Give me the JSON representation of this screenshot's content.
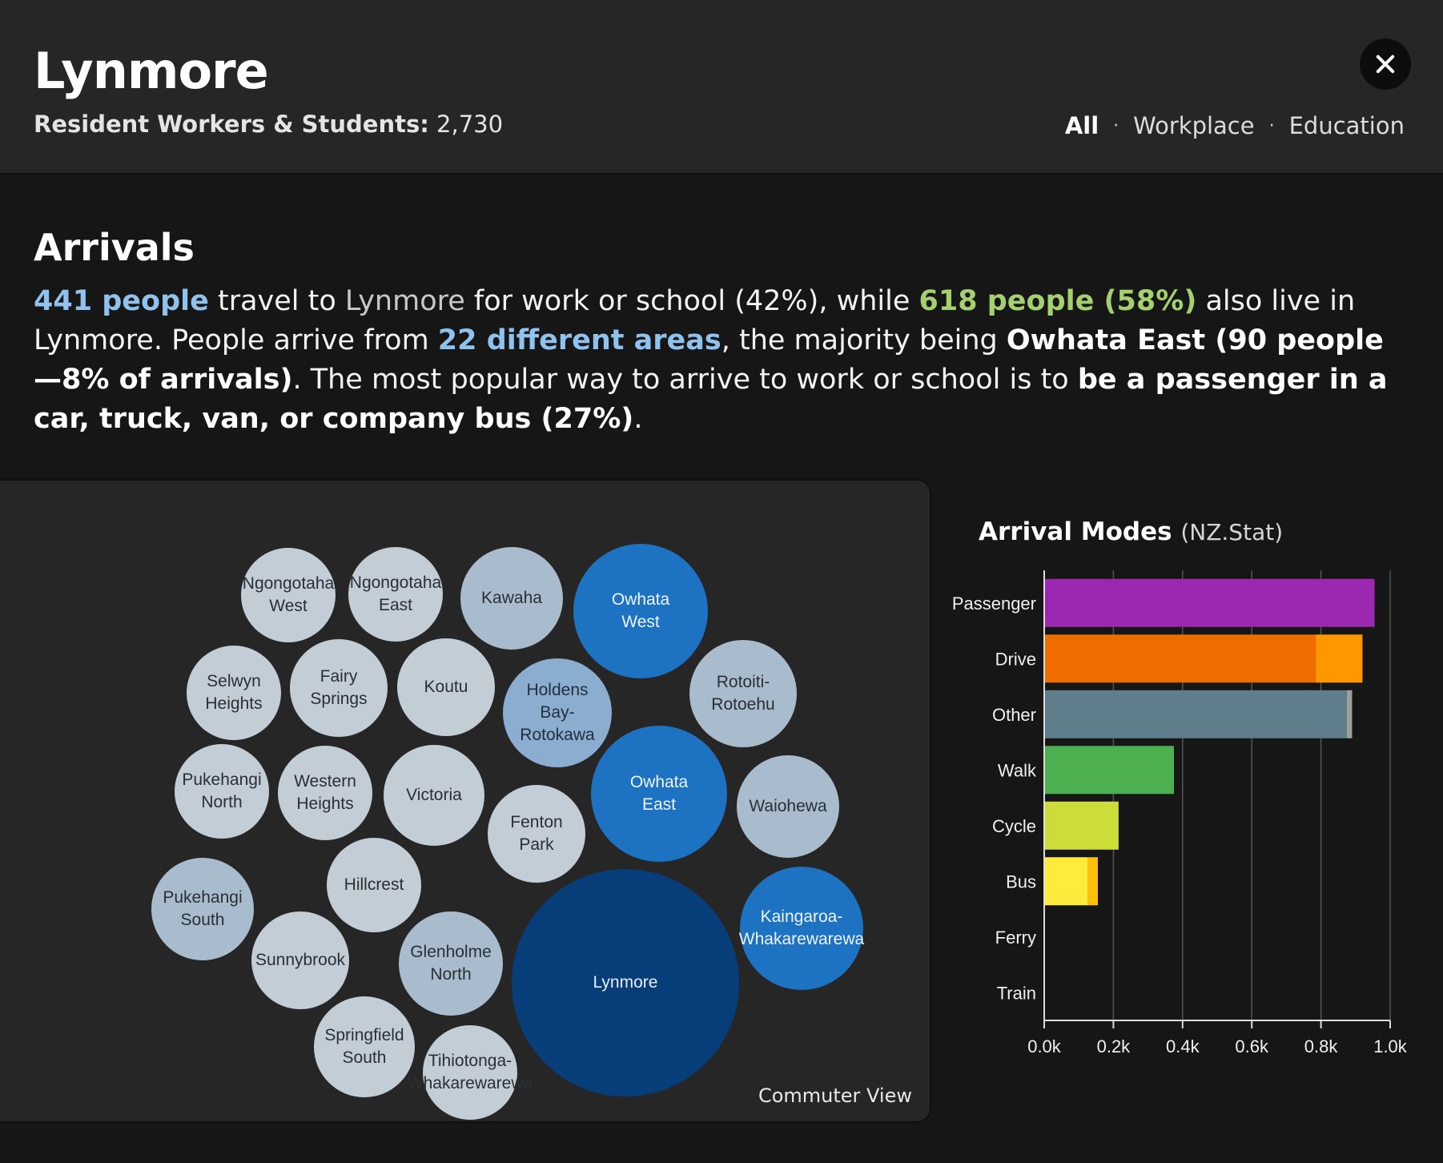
{
  "header": {
    "title": "Lynmore",
    "residents_label": "Resident Workers & Students:",
    "residents_value": "2,730",
    "filters": [
      "All",
      "Workplace",
      "Education"
    ],
    "active_filter": "All"
  },
  "arrivals": {
    "heading": "Arrivals",
    "summary": {
      "p1_count": "441 people",
      "p1_mid": " travel to ",
      "p1_place": "Lynmore",
      "p1_rest": " for work or school (42%), while ",
      "p1_local": "618 people (58%)",
      "p1_end": " also live in Lynmore. People arrive from ",
      "areas": "22 different areas",
      "p2_mid": ", the majority being ",
      "top_area": "Owhata East (90 people—8% of arrivals)",
      "p2_end": ". The most popular way to arrive to work or school is to ",
      "top_mode": "be a passenger in a car, truck, van, or company bus (27%)",
      "p3_end": "."
    }
  },
  "bubbles": {
    "items": [
      {
        "label": "Ngongotaha\nWest"
      },
      {
        "label": "Ngongotaha\nEast"
      },
      {
        "label": "Kawaha"
      },
      {
        "label": "Owhata\nWest"
      },
      {
        "label": "Selwyn\nHeights"
      },
      {
        "label": "Fairy\nSprings"
      },
      {
        "label": "Koutu"
      },
      {
        "label": "Holdens\nBay-\nRotokawa"
      },
      {
        "label": "Rotoiti-\nRotoehu"
      },
      {
        "label": "Pukehangi\nNorth"
      },
      {
        "label": "Western\nHeights"
      },
      {
        "label": "Victoria"
      },
      {
        "label": "Fenton\nPark"
      },
      {
        "label": "Owhata\nEast"
      },
      {
        "label": "Waiohewa"
      },
      {
        "label": "Pukehangi\nSouth"
      },
      {
        "label": "Hillcrest"
      },
      {
        "label": "Sunnybrook"
      },
      {
        "label": "Glenholme\nNorth"
      },
      {
        "label": "Lynmore"
      },
      {
        "label": "Kaingaroa-\nWhakarewarewa"
      },
      {
        "label": "Springfield\nSouth"
      },
      {
        "label": "Tihiotonga-\nWhakarewarewa"
      }
    ],
    "view_toggle": "Commuter View"
  },
  "chart_title": "Arrival Modes",
  "chart_source": "(NZ.Stat)",
  "chart_data": {
    "type": "bar",
    "orientation": "horizontal",
    "categories": [
      "Passenger",
      "Drive",
      "Other",
      "Walk",
      "Cycle",
      "Bus",
      "Ferry",
      "Train"
    ],
    "series": [
      {
        "values": [
          955,
          785,
          875,
          375,
          215,
          125,
          0,
          0
        ]
      },
      {
        "values": [
          0,
          135,
          15,
          0,
          0,
          30,
          0,
          0
        ]
      }
    ],
    "colors": [
      "#9c27b0",
      "#ef6c00",
      "#607d8b",
      "#4caf50",
      "#cddc39",
      "#ffeb3b",
      "#888888",
      "#888888"
    ],
    "secondary_colors": [
      "#9c27b0",
      "#ff9800",
      "#9e9e9e",
      "#4caf50",
      "#cddc39",
      "#ffc107",
      "#888888",
      "#888888"
    ],
    "x_ticks": [
      "0.0k",
      "0.2k",
      "0.4k",
      "0.6k",
      "0.8k",
      "1.0k"
    ],
    "xlim": [
      0,
      1000
    ],
    "grid": true
  }
}
